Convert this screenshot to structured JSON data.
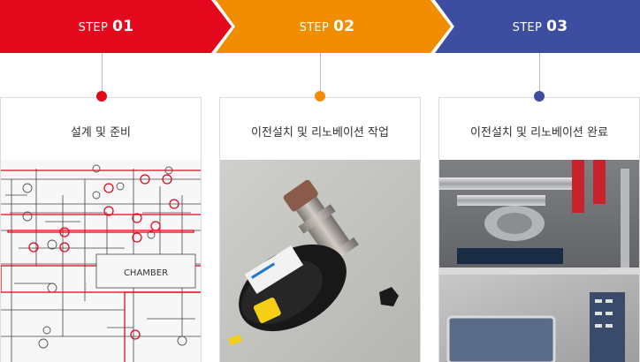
{
  "colors": {
    "step1": "#e3081b",
    "step2": "#f08d00",
    "step3": "#3d4da0"
  },
  "steps": [
    {
      "prefix": "STEP",
      "number": "01",
      "title": "설계 및 준비"
    },
    {
      "prefix": "STEP",
      "number": "02",
      "title": "이전설치 및 리노베이션 작업"
    },
    {
      "prefix": "STEP",
      "number": "03",
      "title": "이전설치 및 리노베이션 완료"
    }
  ],
  "diagram": {
    "chamber_label": "CHAMBER"
  }
}
